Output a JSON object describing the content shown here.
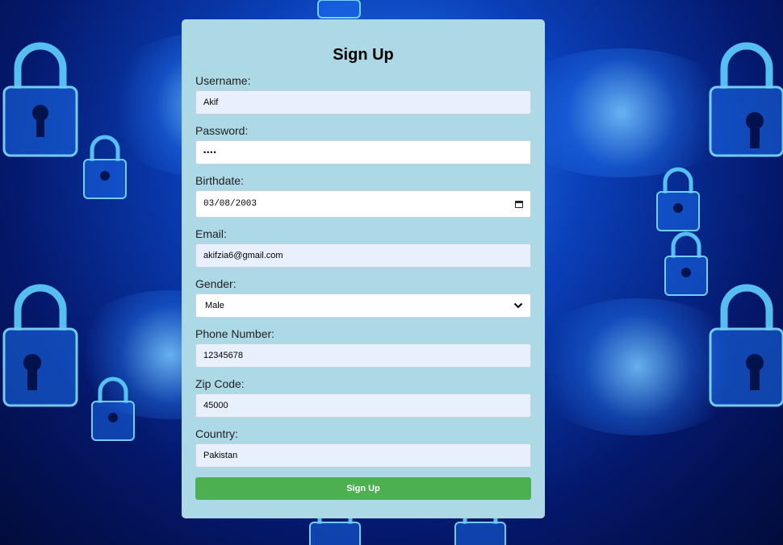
{
  "form": {
    "title": "Sign Up",
    "fields": {
      "username": {
        "label": "Username:",
        "value": "Akif"
      },
      "password": {
        "label": "Password:",
        "value": "••••"
      },
      "birthdate": {
        "label": "Birthdate:",
        "value": "03/08/2003"
      },
      "email": {
        "label": "Email:",
        "value": "akifzia6@gmail.com"
      },
      "gender": {
        "label": "Gender:",
        "value": "Male"
      },
      "phone": {
        "label": "Phone Number:",
        "value": "12345678"
      },
      "zip": {
        "label": "Zip Code:",
        "value": "45000"
      },
      "country": {
        "label": "Country:",
        "value": "Pakistan"
      }
    },
    "submit_label": "Sign Up"
  },
  "icons": {
    "birthdate": "calendar-icon",
    "gender": "chevron-down-icon",
    "background": "padlock-icon"
  },
  "colors": {
    "card": "#add8e6",
    "submit": "#4caf50",
    "autofill": "#e8f0fe",
    "background": "#0a3fb8"
  }
}
